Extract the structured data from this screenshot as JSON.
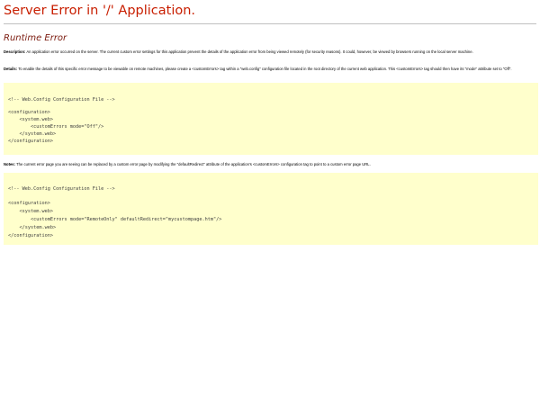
{
  "page_title": "Server Error in '/' Application.",
  "error_heading": "Runtime Error",
  "description": {
    "label": "Description:",
    "text": " An application error occurred on the server. The current custom error settings for this application prevent the details of the application error from being viewed remotely (for security reasons). It could, however, be viewed by browsers running on the local server machine."
  },
  "details": {
    "label": "Details:",
    "text": " To enable the details of this specific error message to be viewable on remote machines, please create a <customErrors> tag within a \"web.config\" configuration file located in the root directory of the current web application. This <customErrors> tag should then have its \"mode\" attribute set to \"Off\"."
  },
  "code_block_1": {
    "lines": [
      "<!-- Web.Config Configuration File -->",
      "",
      "<configuration>",
      "    <system.web>",
      "        <customErrors mode=\"Off\"/>",
      "    </system.web>",
      "</configuration>"
    ]
  },
  "notes": {
    "label": "Notes:",
    "text": " The current error page you are seeing can be replaced by a custom error page by modifying the \"defaultRedirect\" attribute of the application's <customErrors> configuration tag to point to a custom error page URL."
  },
  "code_block_2": {
    "lines": [
      "<!-- Web.Config Configuration File -->",
      "",
      "<configuration>",
      "    <system.web>",
      "        <customErrors mode=\"RemoteOnly\" defaultRedirect=\"mycustompage.htm\"/>",
      "    </system.web>",
      "</configuration>"
    ]
  },
  "colors": {
    "title": "#c81e00",
    "heading": "#7b1a0e",
    "code_background": "#ffffcc",
    "code_text": "#404040",
    "rule": "#c0c0c0"
  }
}
